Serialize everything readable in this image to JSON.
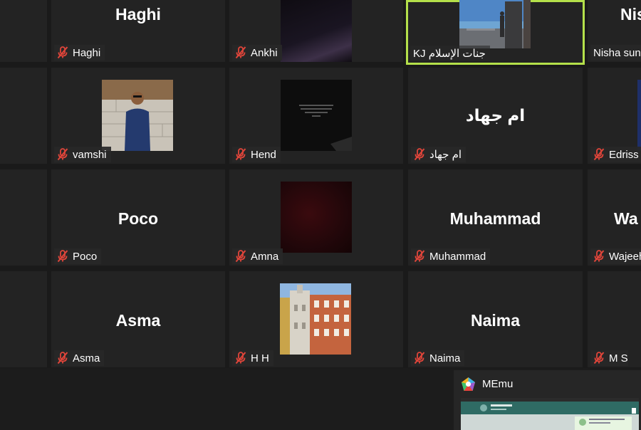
{
  "participants": [
    {
      "display_name": "Haghi",
      "label": "Haghi"
    },
    {
      "label": "Ankhi"
    },
    {
      "label": "KJ جنات الإسلام"
    },
    {
      "display_name": "Nis",
      "label": "Nisha sung"
    },
    {
      "label": "vamshi"
    },
    {
      "label": "Hend"
    },
    {
      "display_name": "ام جهاد",
      "label": "ام جهاد"
    },
    {
      "label": "Edriss S"
    },
    {
      "display_name": "Poco",
      "label": "Poco"
    },
    {
      "label": "Amna"
    },
    {
      "display_name": "Muhammad",
      "label": "Muhammad"
    },
    {
      "display_name": "Wa",
      "label": "Wajeeh"
    },
    {
      "display_name": "Asma",
      "label": "Asma"
    },
    {
      "label": "H H"
    },
    {
      "display_name": "Naima",
      "label": "Naima"
    },
    {
      "label": "M S"
    }
  ],
  "memu": {
    "title": "MEmu"
  },
  "colors": {
    "active_speaker_border": "#b4e04a",
    "tile_bg": "#232323",
    "muted_icon": "#e0453a"
  }
}
